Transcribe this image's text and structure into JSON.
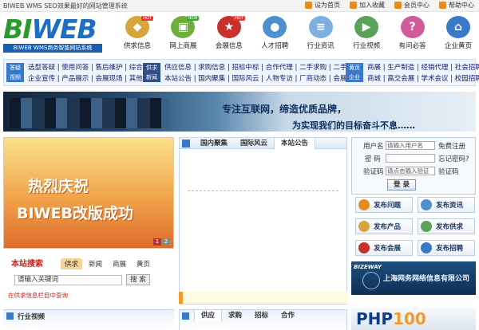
{
  "topbar": {
    "slogan": "BIWEB WMS SEO效果最好的网站管理系统",
    "links": [
      {
        "label": "设为首页",
        "icon": "home-icon",
        "color": "#e58a1f"
      },
      {
        "label": "加入收藏",
        "icon": "bookmark-icon",
        "color": "#e58a1f"
      },
      {
        "label": "会员中心",
        "icon": "member-icon",
        "color": "#e58a1f"
      },
      {
        "label": "帮助中心",
        "icon": "help-icon",
        "color": "#e58a1f"
      }
    ]
  },
  "logo": {
    "bi": "BI",
    "web": "WEB",
    "subtitle": "BIWEB WMS商务智能网站系统"
  },
  "nav": [
    {
      "label": "供求信息",
      "icon": "supply-icon",
      "color": "#d7a53b",
      "tag": "HOT"
    },
    {
      "label": "网上商展",
      "icon": "expo-icon",
      "color": "#6fae3a",
      "tag": "NEW"
    },
    {
      "label": "会展信息",
      "icon": "exhibition-icon",
      "color": "#c9302c",
      "tag": "HOT"
    },
    {
      "label": "人才招聘",
      "icon": "recruit-icon",
      "color": "#4f8fd0",
      "tag": ""
    },
    {
      "label": "行业资讯",
      "icon": "news-icon",
      "color": "#7db0e0",
      "tag": ""
    },
    {
      "label": "行业视频",
      "icon": "video-icon",
      "color": "#5aa25a",
      "tag": ""
    },
    {
      "label": "有问必答",
      "icon": "qa-icon",
      "color": "#d05a9a",
      "tag": ""
    },
    {
      "label": "企业黄页",
      "icon": "yellowpage-icon",
      "color": "#3a78c8",
      "tag": ""
    }
  ],
  "catbar": {
    "badge1": [
      "答疑",
      "视频"
    ],
    "col1": [
      "选型答疑 | 使用问答 | 售后维护 | 综合",
      "企业宣传 | 产品展示 | 会展现场 | 其他"
    ],
    "badge2": [
      "供求",
      "新闻"
    ],
    "col2": [
      "供应信息 | 求购信息 | 招标中标 | 合作代理 | 二手求购 | 二手供应",
      "本站公告 | 国内聚集 | 国际风云 | 人物专访 | 厂商动态 | 会展信息"
    ],
    "badge3": [
      "黄页",
      "企业"
    ],
    "col3": [
      "商展 | 生产制造 | 经销代理 | 社会招聘",
      "商城 | 高交会展 | 学术会议 | 校园招聘"
    ]
  },
  "banner": {
    "line1": "专注互联网，缔造优质品牌，",
    "line2": "为实现我们的目标奋斗不息……"
  },
  "slideshow": {
    "line1": "热烈庆祝",
    "line2": "BIWEB改版成功",
    "pages": [
      "1",
      "2"
    ]
  },
  "search": {
    "title": "本站搜索",
    "tabs": [
      "供求",
      "新闻",
      "商展",
      "黄页"
    ],
    "placeholder": "请输入关键词",
    "button": "搜 索",
    "hint": "在供求信息栏目中查询"
  },
  "news_tabs": [
    "国内聚集",
    "国际风云",
    "本站公告"
  ],
  "login": {
    "username_label": "用户名",
    "username_placeholder": "请输入用户名",
    "register": "免费注册",
    "password_label": "密 码",
    "forgot": "忘记密码?",
    "captcha_label": "验证码",
    "captcha_placeholder": "请点击输入验证",
    "captcha_text": "验证码",
    "submit": "登 录"
  },
  "publish_buttons": [
    {
      "label": "发布问题",
      "icon": "question-icon",
      "color": "#e58a1f"
    },
    {
      "label": "发布资讯",
      "icon": "info-icon",
      "color": "#4f8fd0"
    },
    {
      "label": "发布产品",
      "icon": "product-icon",
      "color": "#d7a53b"
    },
    {
      "label": "发布供求",
      "icon": "supply-icon",
      "color": "#5aa25a"
    },
    {
      "label": "发布会展",
      "icon": "star-icon",
      "color": "#c9302c"
    },
    {
      "label": "发布招聘",
      "icon": "recruit-icon",
      "color": "#3a78c8"
    }
  ],
  "ad": {
    "brand": "BIZEWAY",
    "text": "上海网务网络信息有限公司"
  },
  "video_title": "行业视频",
  "bottom_tabs": [
    "供应",
    "求购",
    "招标",
    "合作"
  ],
  "php_ad": {
    "prefix": "PHP",
    "num": "100"
  }
}
